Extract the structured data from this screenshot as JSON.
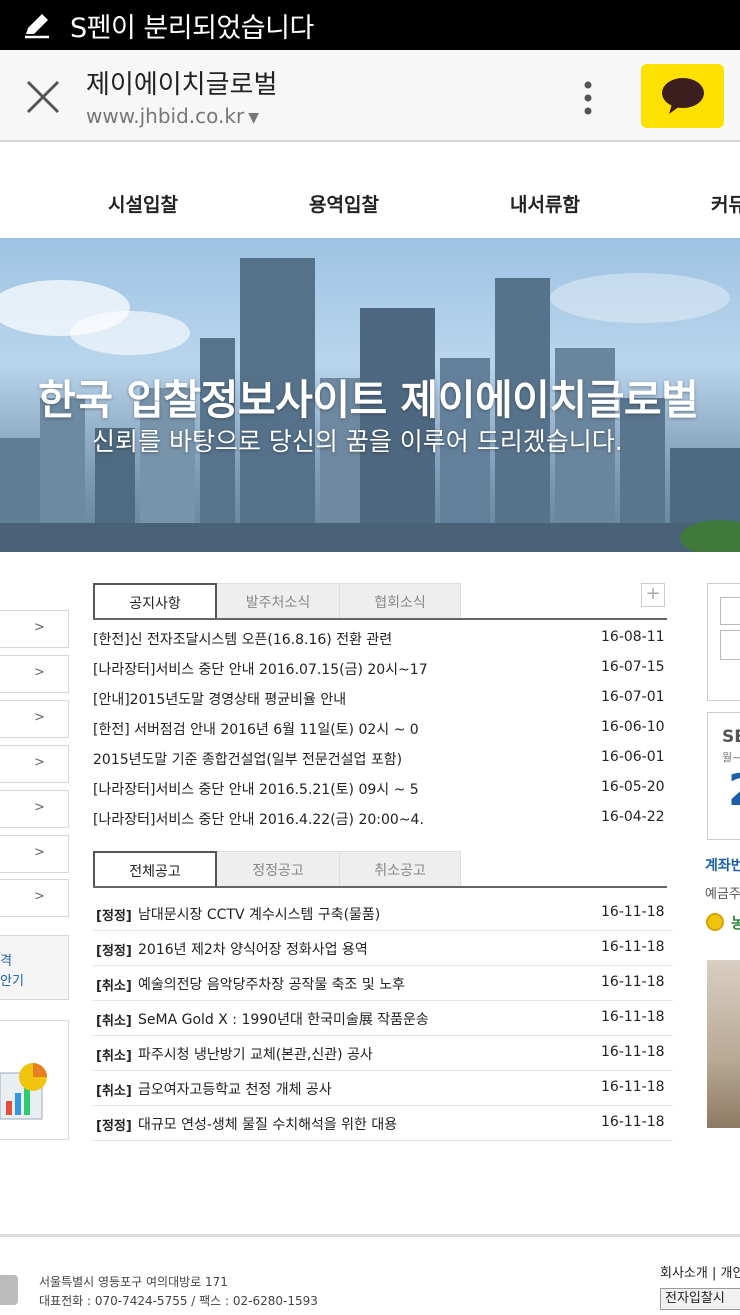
{
  "status_bar": {
    "message": "S펜이 분리되었습니다"
  },
  "browser": {
    "title": "제이에이치글로벌",
    "url": "www.jhbid.co.kr"
  },
  "nav": {
    "items": [
      "시설입찰",
      "용역입찰",
      "내서류함",
      "커뮤"
    ]
  },
  "banner": {
    "headline": "한국 입찰정보사이트 제이에이치글로벌",
    "subline": "신뢰를 바탕으로 당신의 꿈을 이루어 드리겠습니다."
  },
  "sidebar": {
    "arrow": ">",
    "box_line1": "격",
    "box_line2": "안기"
  },
  "notice_tabs": {
    "tabs": [
      "공지사항",
      "발주처소식",
      "협회소식"
    ],
    "plus": "+"
  },
  "notices": [
    {
      "title": "[한전]신 전자조달시스템 오픈(16.8.16) 전환 관련",
      "date": "16-08-11"
    },
    {
      "title": "[나라장터]서비스 중단 안내 2016.07.15(금) 20시~17",
      "date": "16-07-15"
    },
    {
      "title": "[안내]2015년도말 경영상태 평균비율 안내",
      "date": "16-07-01"
    },
    {
      "title": "[한전] 서버점검 안내 2016년 6월 11일(토) 02시 ~ 0",
      "date": "16-06-10"
    },
    {
      "title": "2015년도말 기준 종합건설업(일부 전문건설업 포함)",
      "date": "16-06-01"
    },
    {
      "title": "[나라장터]서비스 중단 안내 2016.5.21(토) 09시 ~ 5",
      "date": "16-05-20"
    },
    {
      "title": "[나라장터]서비스 중단 안내 2016.4.22(금) 20:00~4.",
      "date": "16-04-22"
    }
  ],
  "bid_tabs": {
    "tabs": [
      "전체공고",
      "정정공고",
      "취소공고"
    ]
  },
  "bids": [
    {
      "tag": "[정정]",
      "title": "남대문시장 CCTV 계수시스템 구축(물품)",
      "date": "16-11-18"
    },
    {
      "tag": "[정정]",
      "title": "2016년 제2차 양식어장 정화사업 용역",
      "date": "16-11-18"
    },
    {
      "tag": "[취소]",
      "title": "예술의전당 음악당주차장 공작물 축조 및 노후",
      "date": "16-11-18"
    },
    {
      "tag": "[취소]",
      "title": "SeMA Gold X : 1990년대 한국미술展 작품운송",
      "date": "16-11-18"
    },
    {
      "tag": "[취소]",
      "title": "파주시청 냉난방기 교체(본관,신관) 공사",
      "date": "16-11-18"
    },
    {
      "tag": "[취소]",
      "title": "금오여자고등학교 천정 개체 공사",
      "date": "16-11-18"
    },
    {
      "tag": "[정정]",
      "title": "대규모 연성-생체 물질 수치해석을 위한 대용",
      "date": "16-11-18"
    }
  ],
  "right_column": {
    "card_prefix": "SE",
    "card_small": "월~",
    "card_big": "2",
    "account": "계좌번",
    "deposit": "예금주",
    "medal_text": "농"
  },
  "footer": {
    "address": "서울특별시 영등포구 여의대방로 171",
    "phone": "대표전화 : 070-7424-5755 / 팩스 : 02-6280-1593",
    "links": "회사소개 | 개인",
    "button": "전자입찰시"
  },
  "colors": {
    "kakao": "#ffe100",
    "accent_blue": "#1a5fa8"
  }
}
